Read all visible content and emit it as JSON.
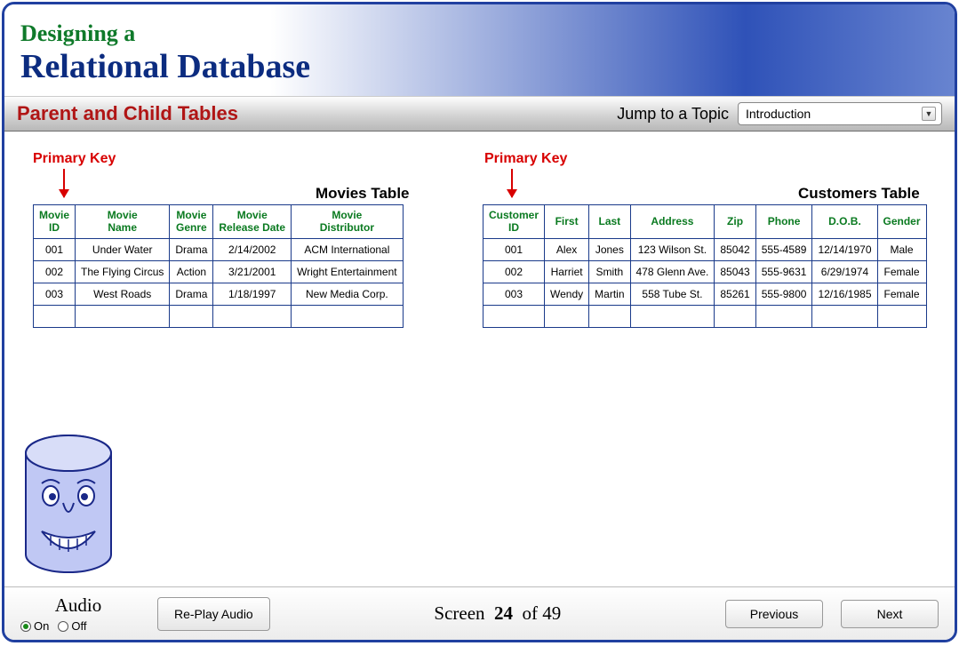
{
  "header": {
    "line1": "Designing a",
    "line2": "Relational Database"
  },
  "subbar": {
    "topicTitle": "Parent and Child Tables",
    "jumpLabel": "Jump to a Topic",
    "jumpSelected": "Introduction"
  },
  "content": {
    "primaryKeyLabel": "Primary Key",
    "moviesTableTitle": "Movies Table",
    "customersTableTitle": "Customers Table",
    "moviesHeaders": [
      "Movie\nID",
      "Movie\nName",
      "Movie\nGenre",
      "Movie\nRelease Date",
      "Movie\nDistributor"
    ],
    "moviesRows": [
      [
        "001",
        "Under Water",
        "Drama",
        "2/14/2002",
        "ACM International"
      ],
      [
        "002",
        "The Flying Circus",
        "Action",
        "3/21/2001",
        "Wright Entertainment"
      ],
      [
        "003",
        "West Roads",
        "Drama",
        "1/18/1997",
        "New Media Corp."
      ]
    ],
    "customersHeaders": [
      "Customer\nID",
      "First",
      "Last",
      "Address",
      "Zip",
      "Phone",
      "D.O.B.",
      "Gender"
    ],
    "customersRows": [
      [
        "001",
        "Alex",
        "Jones",
        "123 Wilson St.",
        "85042",
        "555-4589",
        "12/14/1970",
        "Male"
      ],
      [
        "002",
        "Harriet",
        "Smith",
        "478 Glenn Ave.",
        "85043",
        "555-9631",
        "6/29/1974",
        "Female"
      ],
      [
        "003",
        "Wendy",
        "Martin",
        "558 Tube St.",
        "85261",
        "555-9800",
        "12/16/1985",
        "Female"
      ]
    ]
  },
  "footer": {
    "audioTitle": "Audio",
    "audioOn": "On",
    "audioOff": "Off",
    "replayLabel": "Re-Play Audio",
    "screenWord": "Screen",
    "screenCurrent": "24",
    "screenOf": "of",
    "screenTotal": "49",
    "previousLabel": "Previous",
    "nextLabel": "Next"
  }
}
